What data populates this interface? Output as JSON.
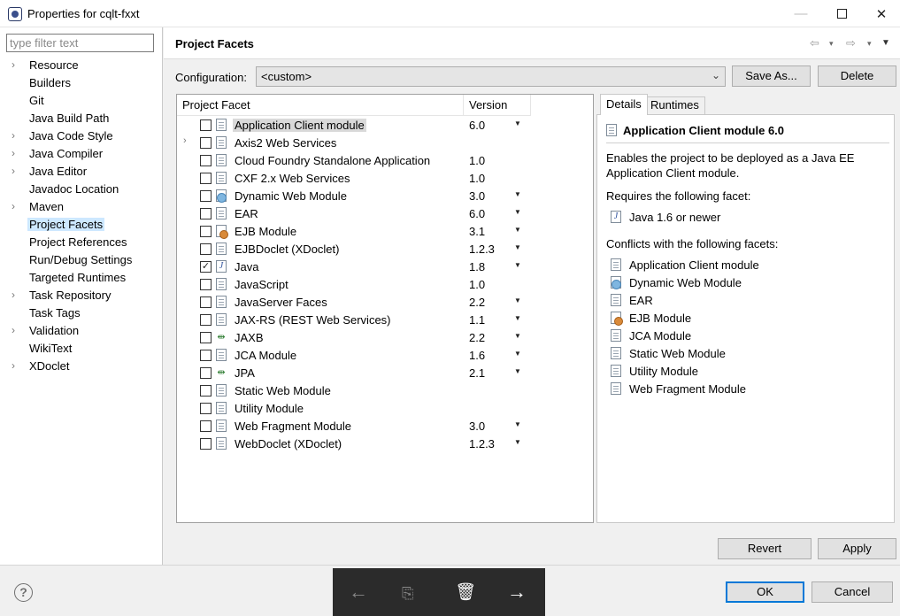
{
  "window": {
    "title": "Properties for cqlt-fxxt",
    "minimize": "—",
    "close": "✕"
  },
  "sidebar": {
    "filter_placeholder": "type filter text",
    "items": [
      {
        "label": "Resource",
        "expandable": true,
        "selected": false
      },
      {
        "label": "Builders",
        "expandable": false,
        "selected": false
      },
      {
        "label": "Git",
        "expandable": false,
        "selected": false
      },
      {
        "label": "Java Build Path",
        "expandable": false,
        "selected": false
      },
      {
        "label": "Java Code Style",
        "expandable": true,
        "selected": false
      },
      {
        "label": "Java Compiler",
        "expandable": true,
        "selected": false
      },
      {
        "label": "Java Editor",
        "expandable": true,
        "selected": false
      },
      {
        "label": "Javadoc Location",
        "expandable": false,
        "selected": false
      },
      {
        "label": "Maven",
        "expandable": true,
        "selected": false
      },
      {
        "label": "Project Facets",
        "expandable": false,
        "selected": true
      },
      {
        "label": "Project References",
        "expandable": false,
        "selected": false
      },
      {
        "label": "Run/Debug Settings",
        "expandable": false,
        "selected": false
      },
      {
        "label": "Targeted Runtimes",
        "expandable": false,
        "selected": false
      },
      {
        "label": "Task Repository",
        "expandable": true,
        "selected": false
      },
      {
        "label": "Task Tags",
        "expandable": false,
        "selected": false
      },
      {
        "label": "Validation",
        "expandable": true,
        "selected": false
      },
      {
        "label": "WikiText",
        "expandable": false,
        "selected": false
      },
      {
        "label": "XDoclet",
        "expandable": true,
        "selected": false
      }
    ]
  },
  "page": {
    "title": "Project Facets",
    "nav": {
      "back": "⇦",
      "forward": "⇨",
      "dropdown": "▾",
      "menu": "▼"
    }
  },
  "configuration": {
    "label": "Configuration:",
    "value": "<custom>",
    "save_as_label": "Save As...",
    "delete_label": "Delete"
  },
  "facets": {
    "headers": {
      "facet": "Project Facet",
      "version": "Version"
    },
    "rows": [
      {
        "name": "Application Client module",
        "version": "6.0",
        "dropdown": true,
        "checked": false,
        "expandable": false,
        "icon": "page-icon",
        "selected": true
      },
      {
        "name": "Axis2 Web Services",
        "version": "",
        "dropdown": false,
        "checked": false,
        "expandable": true,
        "icon": "page-icon",
        "selected": false
      },
      {
        "name": "Cloud Foundry Standalone Application",
        "version": "1.0",
        "dropdown": false,
        "checked": false,
        "expandable": false,
        "icon": "page-icon",
        "selected": false
      },
      {
        "name": "CXF 2.x Web Services",
        "version": "1.0",
        "dropdown": false,
        "checked": false,
        "expandable": false,
        "icon": "page-icon",
        "selected": false
      },
      {
        "name": "Dynamic Web Module",
        "version": "3.0",
        "dropdown": true,
        "checked": false,
        "expandable": false,
        "icon": "web-module-icon",
        "selected": false
      },
      {
        "name": "EAR",
        "version": "6.0",
        "dropdown": true,
        "checked": false,
        "expandable": false,
        "icon": "page-icon",
        "selected": false
      },
      {
        "name": "EJB Module",
        "version": "3.1",
        "dropdown": true,
        "checked": false,
        "expandable": false,
        "icon": "ejb-icon",
        "selected": false
      },
      {
        "name": "EJBDoclet (XDoclet)",
        "version": "1.2.3",
        "dropdown": true,
        "checked": false,
        "expandable": false,
        "icon": "page-icon",
        "selected": false
      },
      {
        "name": "Java",
        "version": "1.8",
        "dropdown": true,
        "checked": true,
        "expandable": false,
        "icon": "java-icon",
        "selected": false
      },
      {
        "name": "JavaScript",
        "version": "1.0",
        "dropdown": false,
        "checked": false,
        "expandable": false,
        "icon": "page-icon",
        "selected": false
      },
      {
        "name": "JavaServer Faces",
        "version": "2.2",
        "dropdown": true,
        "checked": false,
        "expandable": false,
        "icon": "page-icon",
        "selected": false
      },
      {
        "name": "JAX-RS (REST Web Services)",
        "version": "1.1",
        "dropdown": true,
        "checked": false,
        "expandable": false,
        "icon": "page-icon",
        "selected": false
      },
      {
        "name": "JAXB",
        "version": "2.2",
        "dropdown": true,
        "checked": false,
        "expandable": false,
        "icon": "arrows-icon",
        "selected": false
      },
      {
        "name": "JCA Module",
        "version": "1.6",
        "dropdown": true,
        "checked": false,
        "expandable": false,
        "icon": "page-icon",
        "selected": false
      },
      {
        "name": "JPA",
        "version": "2.1",
        "dropdown": true,
        "checked": false,
        "expandable": false,
        "icon": "arrows-icon",
        "selected": false
      },
      {
        "name": "Static Web Module",
        "version": "",
        "dropdown": false,
        "checked": false,
        "expandable": false,
        "icon": "page-icon",
        "selected": false
      },
      {
        "name": "Utility Module",
        "version": "",
        "dropdown": false,
        "checked": false,
        "expandable": false,
        "icon": "page-icon",
        "selected": false
      },
      {
        "name": "Web Fragment Module",
        "version": "3.0",
        "dropdown": true,
        "checked": false,
        "expandable": false,
        "icon": "page-icon",
        "selected": false
      },
      {
        "name": "WebDoclet (XDoclet)",
        "version": "1.2.3",
        "dropdown": true,
        "checked": false,
        "expandable": false,
        "icon": "page-icon",
        "selected": false
      }
    ]
  },
  "details": {
    "tabs": [
      "Details",
      "Runtimes"
    ],
    "title": "Application Client module 6.0",
    "description": "Enables the project to be deployed as a Java EE Application Client module.",
    "requires_label": "Requires the following facet:",
    "requires": [
      {
        "name": "Java 1.6 or newer",
        "icon": "java-icon"
      }
    ],
    "conflicts_label": "Conflicts with the following facets:",
    "conflicts": [
      {
        "name": "Application Client module",
        "icon": "page-icon"
      },
      {
        "name": "Dynamic Web Module",
        "icon": "web-module-icon"
      },
      {
        "name": "EAR",
        "icon": "page-icon"
      },
      {
        "name": "EJB Module",
        "icon": "ejb-icon"
      },
      {
        "name": "JCA Module",
        "icon": "page-icon"
      },
      {
        "name": "Static Web Module",
        "icon": "page-icon"
      },
      {
        "name": "Utility Module",
        "icon": "page-icon"
      },
      {
        "name": "Web Fragment Module",
        "icon": "page-icon"
      }
    ]
  },
  "buttons": {
    "revert": "Revert",
    "apply": "Apply",
    "ok": "OK",
    "cancel": "Cancel",
    "help": "?"
  },
  "overlay": {
    "back": "←",
    "middle": "⎘",
    "trash": "🗑",
    "forward": "→"
  },
  "colors": {
    "selection": "#cde8ff",
    "focus_border": "#0078d7",
    "overlay_bg": "#2b2b2b"
  }
}
